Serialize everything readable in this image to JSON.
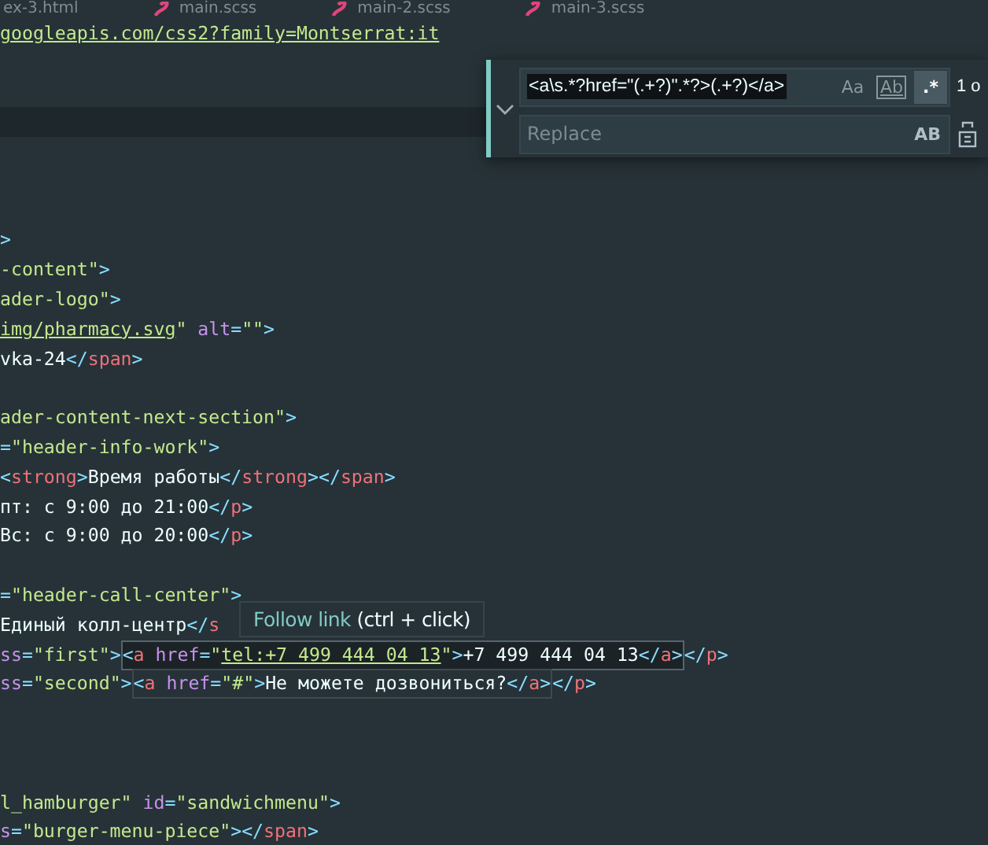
{
  "tabs": [
    {
      "label": "ex-3.html",
      "kind": "html"
    },
    {
      "label": "main.scss",
      "kind": "scss"
    },
    {
      "label": "main-2.scss",
      "kind": "scss"
    },
    {
      "label": "main-3.scss",
      "kind": "scss"
    }
  ],
  "lines": [
    {
      "current": false,
      "segments": [
        {
          "kind": "plain",
          "tokens": [
            {
              "kind": "link",
              "text": "googleapis.com/css2?family=Montserrat:it"
            }
          ]
        }
      ]
    },
    {
      "current": false
    },
    {
      "current": false
    },
    {
      "current": true
    },
    {
      "current": false
    },
    {
      "current": false
    },
    {
      "current": false
    },
    {
      "current": false,
      "segments": [
        {
          "kind": "plain",
          "tokens": [
            {
              "kind": "punct",
              "text": ">"
            }
          ]
        }
      ]
    },
    {
      "current": false,
      "segments": [
        {
          "kind": "plain",
          "tokens": [
            {
              "kind": "string",
              "text": "-content\""
            },
            {
              "kind": "punct",
              "text": ">"
            }
          ]
        }
      ]
    },
    {
      "current": false,
      "segments": [
        {
          "kind": "plain",
          "tokens": [
            {
              "kind": "string",
              "text": "ader-logo\""
            },
            {
              "kind": "punct",
              "text": ">"
            }
          ]
        }
      ]
    },
    {
      "current": false,
      "segments": [
        {
          "kind": "plain",
          "tokens": [
            {
              "kind": "link",
              "text": "img/pharmacy.svg"
            },
            {
              "kind": "string",
              "text": "\""
            },
            {
              "kind": "attr",
              "text": " alt"
            },
            {
              "kind": "punct",
              "text": "="
            },
            {
              "kind": "string",
              "text": "\"\""
            },
            {
              "kind": "punct",
              "text": ">"
            }
          ]
        }
      ]
    },
    {
      "current": false,
      "segments": [
        {
          "kind": "plain",
          "tokens": [
            {
              "kind": "text",
              "text": "vka-24"
            },
            {
              "kind": "punct",
              "text": "</"
            },
            {
              "kind": "tag",
              "text": "span"
            },
            {
              "kind": "punct",
              "text": ">"
            }
          ]
        }
      ]
    },
    {
      "current": false
    },
    {
      "current": false,
      "segments": [
        {
          "kind": "plain",
          "tokens": [
            {
              "kind": "string",
              "text": "ader-content-next-section\""
            },
            {
              "kind": "punct",
              "text": ">"
            }
          ]
        }
      ]
    },
    {
      "current": false,
      "segments": [
        {
          "kind": "plain",
          "tokens": [
            {
              "kind": "punct",
              "text": "="
            },
            {
              "kind": "string",
              "text": "\"header-info-work\""
            },
            {
              "kind": "punct",
              "text": ">"
            }
          ]
        }
      ]
    },
    {
      "current": false,
      "segments": [
        {
          "kind": "plain",
          "tokens": [
            {
              "kind": "punct",
              "text": "<"
            },
            {
              "kind": "tag",
              "text": "strong"
            },
            {
              "kind": "punct",
              "text": ">"
            },
            {
              "kind": "text",
              "text": "Время работы"
            },
            {
              "kind": "punct",
              "text": "</"
            },
            {
              "kind": "tag",
              "text": "strong"
            },
            {
              "kind": "punct",
              "text": "></"
            },
            {
              "kind": "tag",
              "text": "span"
            },
            {
              "kind": "punct",
              "text": ">"
            }
          ]
        }
      ]
    },
    {
      "current": false,
      "segments": [
        {
          "kind": "plain",
          "tokens": [
            {
              "kind": "text",
              "text": "пт: с 9:00 до 21:00"
            },
            {
              "kind": "punct",
              "text": "</"
            },
            {
              "kind": "tag",
              "text": "p"
            },
            {
              "kind": "punct",
              "text": ">"
            }
          ]
        }
      ]
    },
    {
      "current": false,
      "segments": [
        {
          "kind": "plain",
          "tokens": [
            {
              "kind": "text",
              "text": "Вс: с 9:00 до 20:00"
            },
            {
              "kind": "punct",
              "text": "</"
            },
            {
              "kind": "tag",
              "text": "p"
            },
            {
              "kind": "punct",
              "text": ">"
            }
          ]
        }
      ]
    },
    {
      "current": false
    },
    {
      "current": false,
      "segments": [
        {
          "kind": "plain",
          "tokens": [
            {
              "kind": "punct",
              "text": "="
            },
            {
              "kind": "string",
              "text": "\"header-call-center\""
            },
            {
              "kind": "punct",
              "text": ">"
            }
          ]
        }
      ]
    },
    {
      "current": false,
      "segments": [
        {
          "kind": "plain",
          "tokens": [
            {
              "kind": "text",
              "text": "Единый колл-центр"
            },
            {
              "kind": "punct",
              "text": "</"
            },
            {
              "kind": "tag",
              "text": "s"
            }
          ]
        }
      ]
    },
    {
      "current": false,
      "segments": [
        {
          "kind": "plain",
          "tokens": [
            {
              "kind": "attr",
              "text": "ss"
            },
            {
              "kind": "punct",
              "text": "="
            },
            {
              "kind": "string",
              "text": "\"first\""
            },
            {
              "kind": "punct",
              "text": ">"
            }
          ]
        },
        {
          "kind": "match",
          "selected": true,
          "tokens": [
            {
              "kind": "punct",
              "text": "<"
            },
            {
              "kind": "tag",
              "text": "a"
            },
            {
              "kind": "attr",
              "text": " href"
            },
            {
              "kind": "punct",
              "text": "="
            },
            {
              "kind": "string",
              "text": "\""
            },
            {
              "kind": "link",
              "text": "tel:+7 499 444 04 13"
            },
            {
              "kind": "string",
              "text": "\""
            },
            {
              "kind": "punct",
              "text": ">"
            },
            {
              "kind": "text",
              "text": "+7 499 444 04 13"
            },
            {
              "kind": "punct",
              "text": "</"
            },
            {
              "kind": "tag",
              "text": "a"
            },
            {
              "kind": "punct",
              "text": ">"
            }
          ]
        },
        {
          "kind": "plain",
          "tokens": [
            {
              "kind": "punct",
              "text": "</"
            },
            {
              "kind": "tag",
              "text": "p"
            },
            {
              "kind": "punct",
              "text": ">"
            }
          ]
        }
      ]
    },
    {
      "current": false,
      "segments": [
        {
          "kind": "plain",
          "tokens": [
            {
              "kind": "attr",
              "text": "ss"
            },
            {
              "kind": "punct",
              "text": "="
            },
            {
              "kind": "string",
              "text": "\"second\""
            },
            {
              "kind": "punct",
              "text": ">"
            }
          ]
        },
        {
          "kind": "match",
          "selected": false,
          "tokens": [
            {
              "kind": "punct",
              "text": "<"
            },
            {
              "kind": "tag",
              "text": "a"
            },
            {
              "kind": "attr",
              "text": " href"
            },
            {
              "kind": "punct",
              "text": "="
            },
            {
              "kind": "string",
              "text": "\"#\""
            },
            {
              "kind": "punct",
              "text": ">"
            },
            {
              "kind": "text",
              "text": "Не можете дозвониться?"
            },
            {
              "kind": "punct",
              "text": "</"
            },
            {
              "kind": "tag",
              "text": "a"
            },
            {
              "kind": "punct",
              "text": ">"
            }
          ]
        },
        {
          "kind": "plain",
          "tokens": [
            {
              "kind": "punct",
              "text": "</"
            },
            {
              "kind": "tag",
              "text": "p"
            },
            {
              "kind": "punct",
              "text": ">"
            }
          ]
        }
      ]
    },
    {
      "current": false
    },
    {
      "current": false
    },
    {
      "current": false
    },
    {
      "current": false,
      "segments": [
        {
          "kind": "plain",
          "tokens": [
            {
              "kind": "string",
              "text": "l_hamburger\""
            },
            {
              "kind": "attr",
              "text": " id"
            },
            {
              "kind": "punct",
              "text": "="
            },
            {
              "kind": "string",
              "text": "\"sandwichmenu\""
            },
            {
              "kind": "punct",
              "text": ">"
            }
          ]
        }
      ]
    },
    {
      "current": false,
      "segments": [
        {
          "kind": "plain",
          "tokens": [
            {
              "kind": "attr",
              "text": "s"
            },
            {
              "kind": "punct",
              "text": "="
            },
            {
              "kind": "string",
              "text": "\"burger-menu-piece\""
            },
            {
              "kind": "punct",
              "text": "></"
            },
            {
              "kind": "tag",
              "text": "span"
            },
            {
              "kind": "punct",
              "text": ">"
            }
          ]
        }
      ]
    }
  ],
  "tooltip": {
    "link_label": "Follow link",
    "hint": "(ctrl + click)"
  },
  "find": {
    "value": "<a\\s.*?href=\"(.+?)\".*?>(.+?)</a>",
    "match_count": "1 o",
    "options": [
      {
        "label": "Aa",
        "kind": "case",
        "on": false
      },
      {
        "label": "Ab",
        "kind": "word",
        "on": false
      },
      {
        "label": ".*",
        "kind": "regex",
        "on": true
      }
    ],
    "replace_placeholder": "Replace",
    "preserve_case": "AB"
  }
}
